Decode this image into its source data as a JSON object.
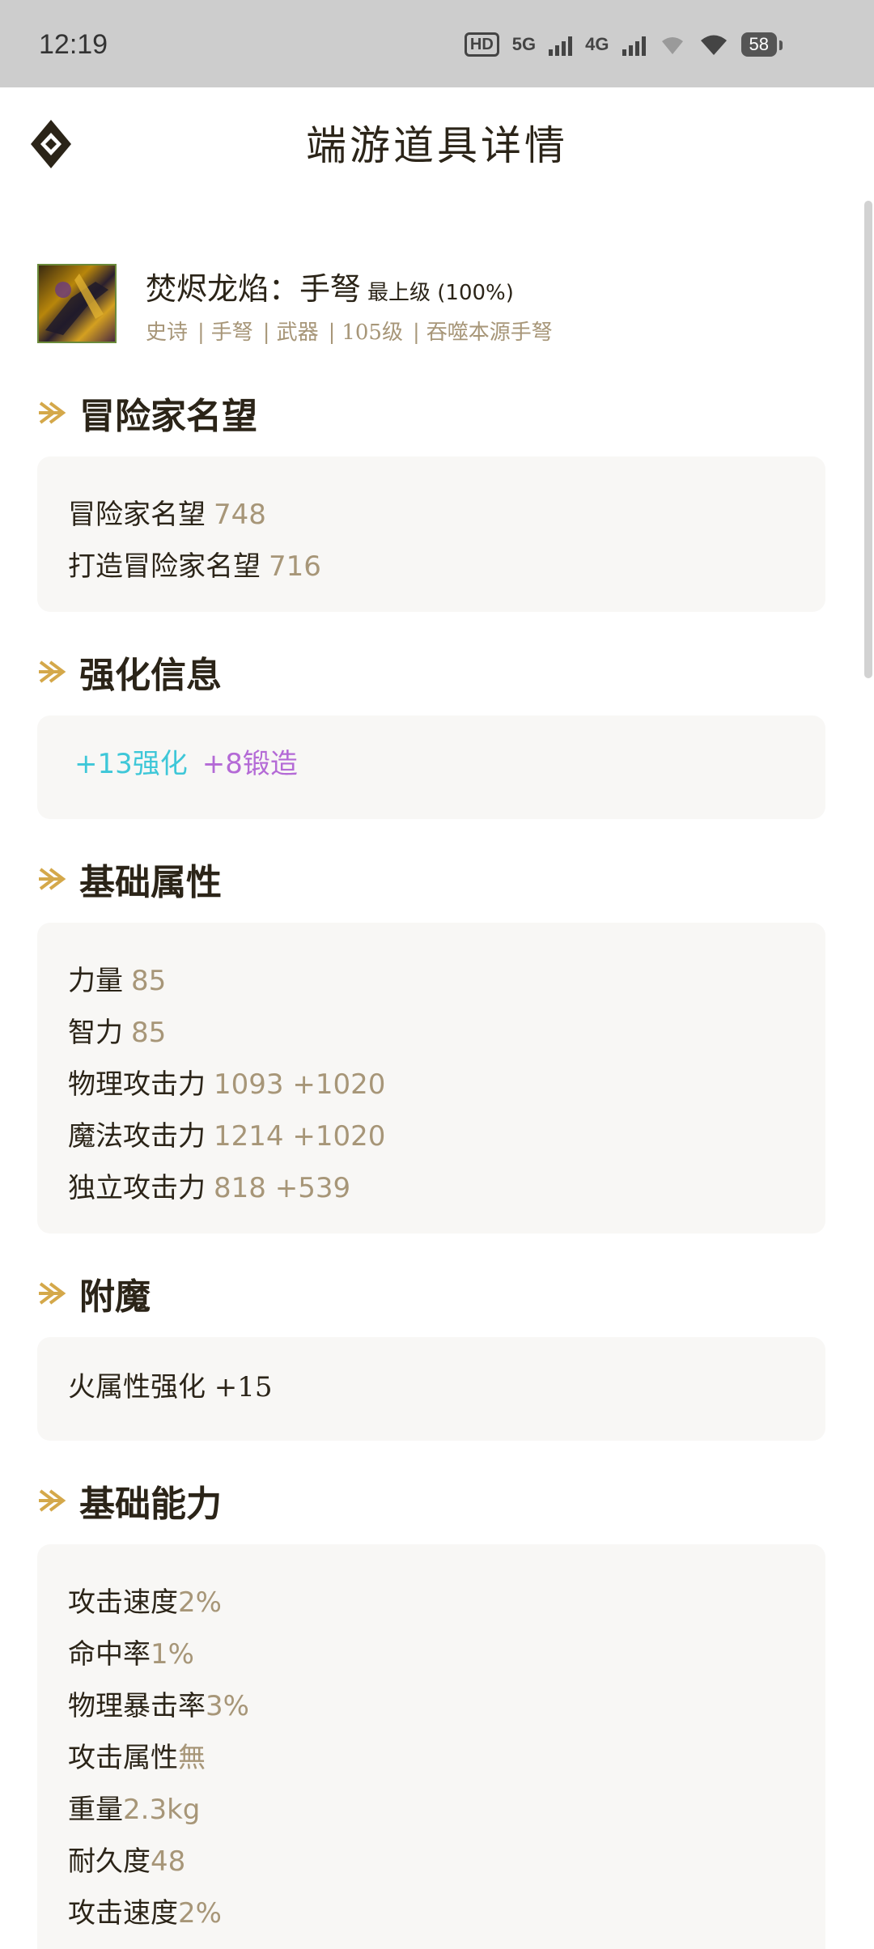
{
  "status_bar": {
    "time": "12:19",
    "hd_label": "HD",
    "net1": "5G",
    "net2": "4G",
    "battery": "58"
  },
  "header": {
    "title": "端游道具详情",
    "logo_icon": "diamond-logo-icon"
  },
  "item": {
    "name": "焚烬龙焰：手弩",
    "grade": "最上级 (100%)",
    "tags": [
      "史诗",
      "手弩",
      "武器",
      "105级",
      "吞噬本源手弩"
    ]
  },
  "sections": {
    "reputation": {
      "title": "冒险家名望",
      "rows": [
        {
          "label": "冒险家名望",
          "value": "748"
        },
        {
          "label": "打造冒险家名望",
          "value": "716"
        }
      ]
    },
    "enhance": {
      "title": "强化信息",
      "enhance_text": "+13强化",
      "forge_text": "+8锻造",
      "enhance_color": "#3ec7d8",
      "forge_color": "#b46ad6"
    },
    "base_stats": {
      "title": "基础属性",
      "rows": [
        {
          "label": "力量",
          "value": "85"
        },
        {
          "label": "智力",
          "value": "85"
        },
        {
          "label": "物理攻击力",
          "value": "1093 +1020"
        },
        {
          "label": "魔法攻击力",
          "value": "1214 +1020"
        },
        {
          "label": "独立攻击力",
          "value": "818 +539"
        }
      ]
    },
    "enchant": {
      "title": "附魔",
      "rows": [
        {
          "label": "火属性强化 +15"
        }
      ]
    },
    "abilities": {
      "title": "基础能力",
      "rows": [
        {
          "label": "攻击速度",
          "value": "2%"
        },
        {
          "label": "命中率",
          "value": "1%"
        },
        {
          "label": "物理暴击率",
          "value": "3%"
        },
        {
          "label": "攻击属性",
          "value": "無"
        },
        {
          "label": "重量",
          "value": "2.3kg"
        },
        {
          "label": "耐久度",
          "value": "48"
        },
        {
          "label": "攻击速度",
          "value": "2%"
        }
      ]
    }
  },
  "colors": {
    "accent_gold": "#d4a84a",
    "value_gray": "#a79678",
    "card_bg": "#f8f7f5"
  }
}
